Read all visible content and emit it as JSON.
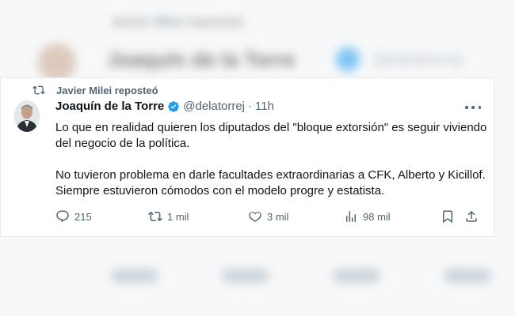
{
  "background": {
    "repost_text": "Javier Milei reposteó",
    "author_name": "Joaquín de la Torre",
    "author_handle": "@delatorrej"
  },
  "tweet": {
    "repost_label": "Javier Milei reposteó",
    "author_name": "Joaquín de la Torre",
    "author_handle": "@delatorrej",
    "separator": "·",
    "time": "11h",
    "paragraph_1": "Lo que en realidad quieren los diputados del \"bloque extorsión\" es seguir viviendo del negocio de la política.",
    "paragraph_2": "No tuvieron problema en darle facultades extraordinarias a CFK, Alberto y Kicillof. Siempre estuvieron cómodos con el modelo progre y estatista.",
    "verified_color": "#1d9bf0"
  },
  "actions": {
    "replies": "215",
    "reposts": "1 mil",
    "likes": "3 mil",
    "views": "98 mil"
  }
}
